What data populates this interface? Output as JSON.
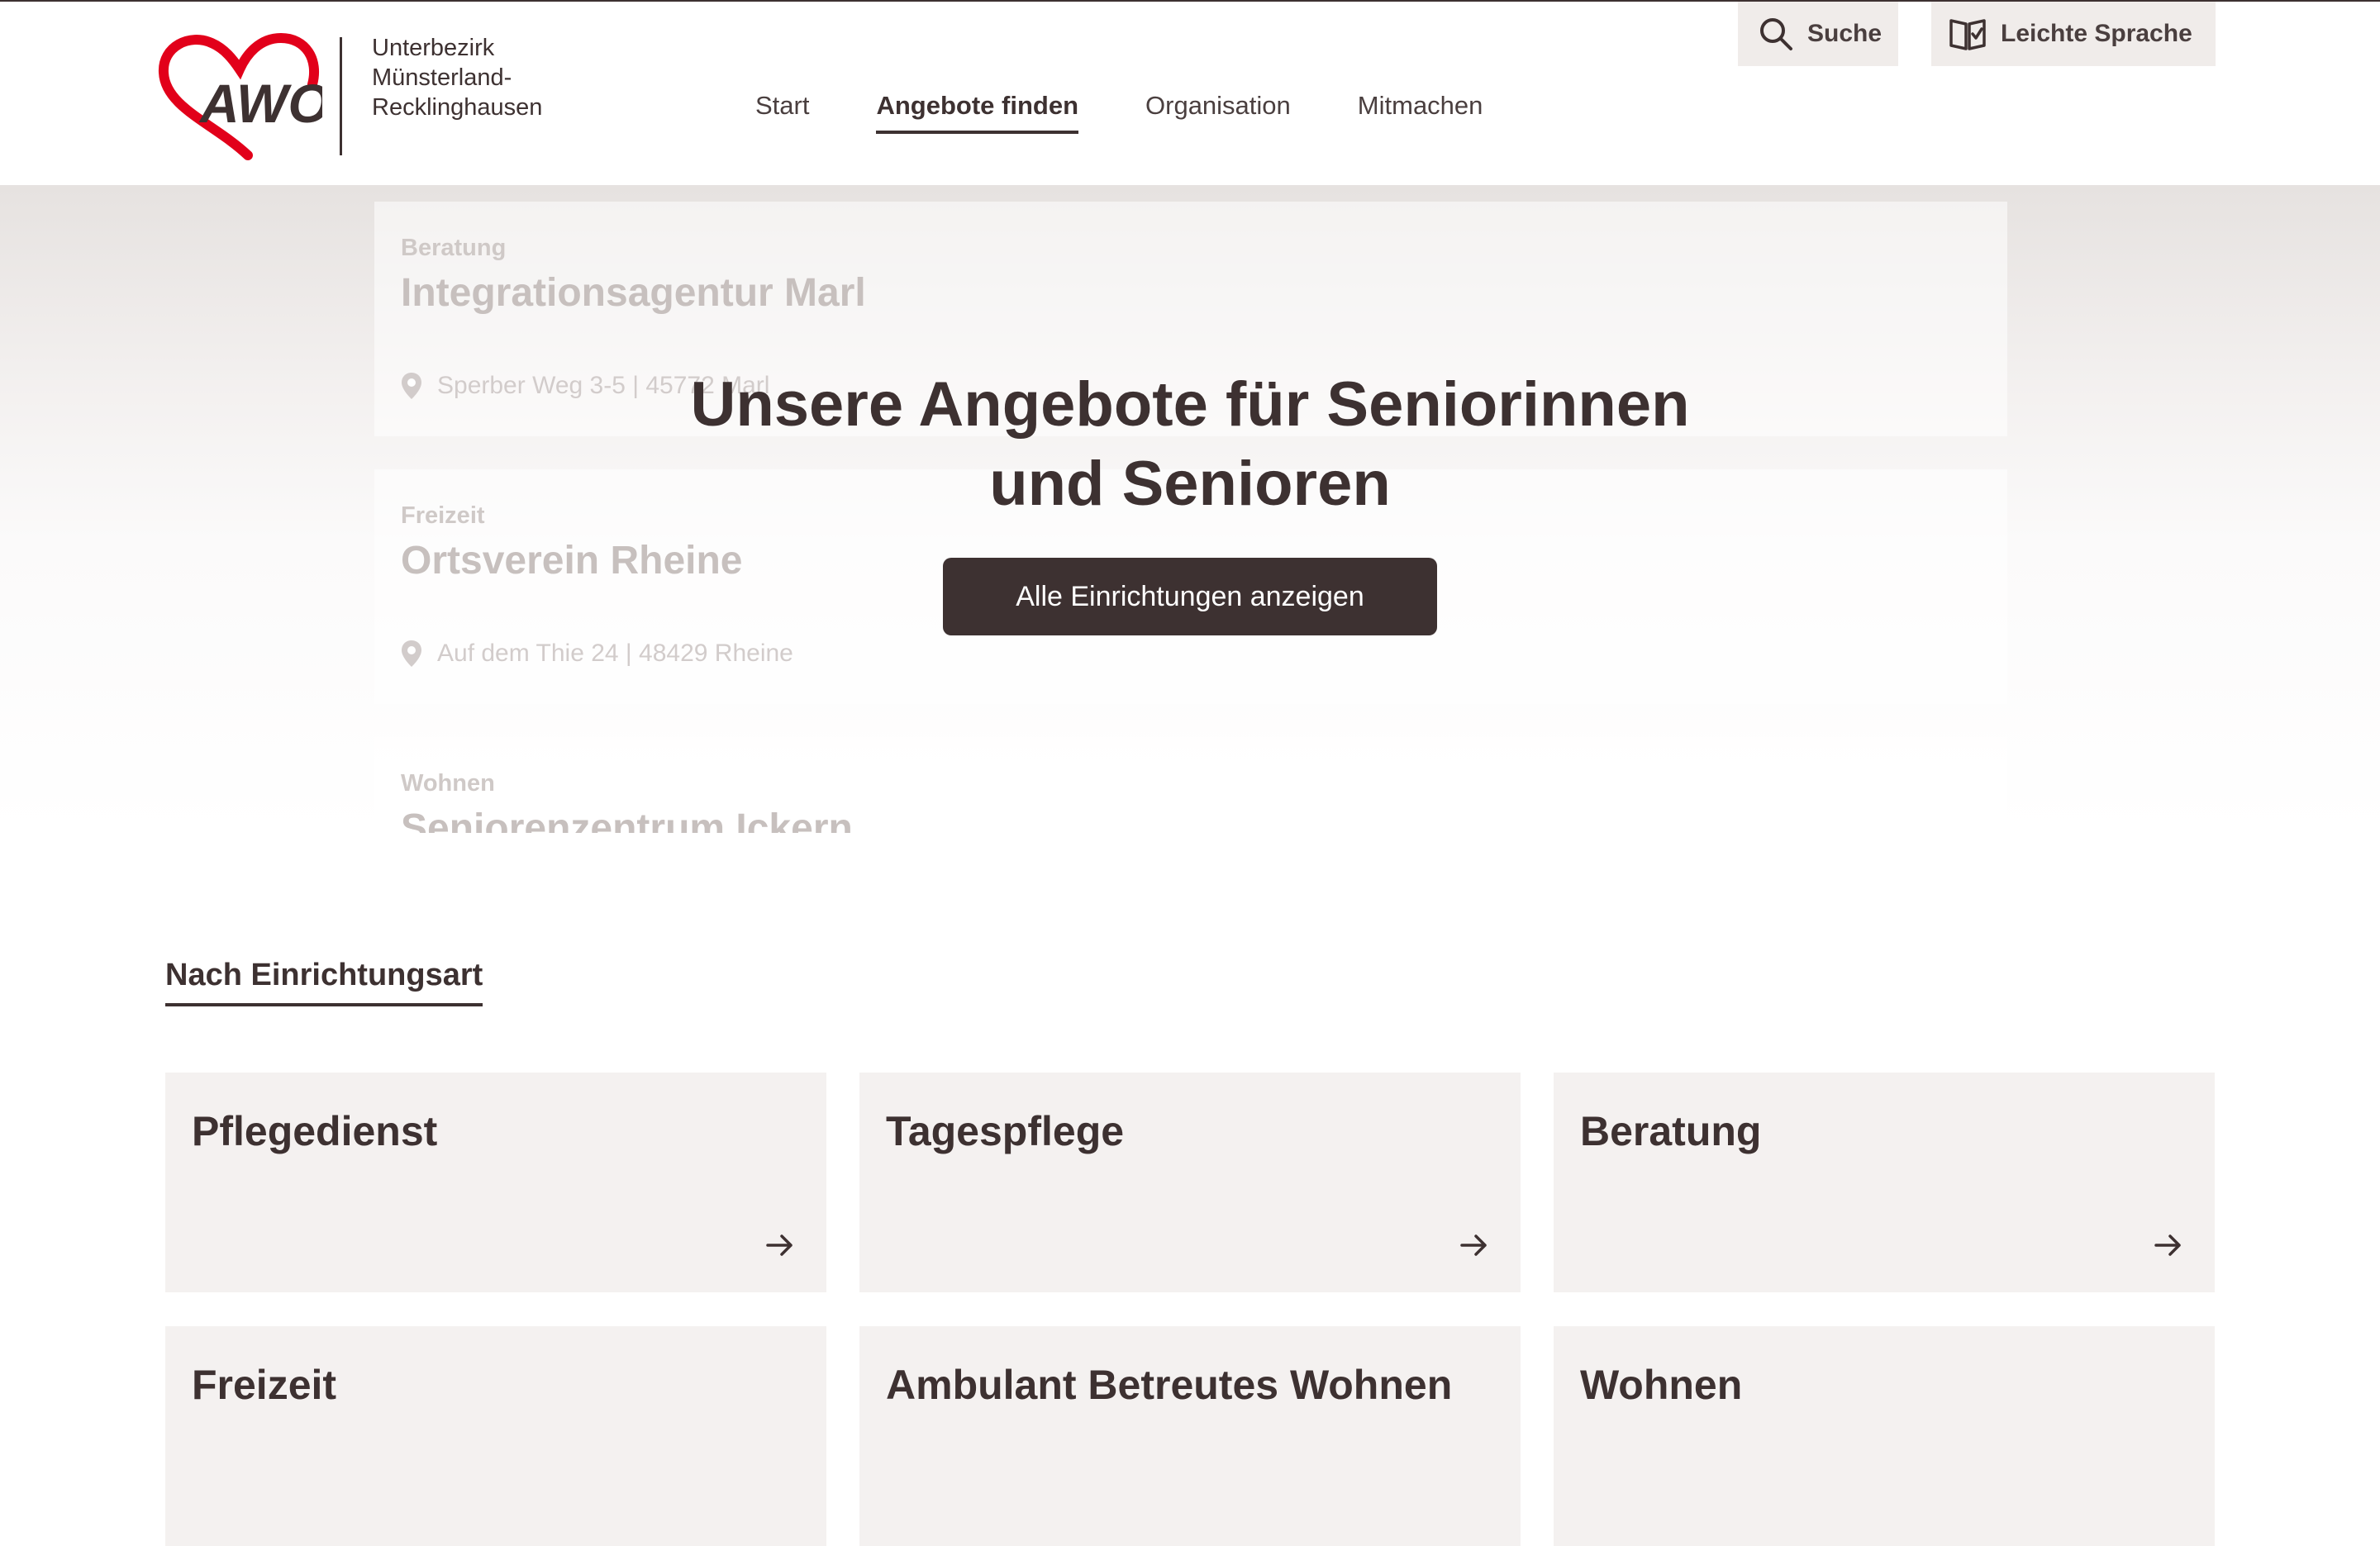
{
  "header": {
    "logo": {
      "mark_text": "AWO",
      "org_lines": [
        "Unterbezirk",
        "Münsterland-",
        "Recklinghausen"
      ]
    },
    "nav": [
      {
        "label": "Start",
        "active": false
      },
      {
        "label": "Angebote finden",
        "active": true
      },
      {
        "label": "Organisation",
        "active": false
      },
      {
        "label": "Mitmachen",
        "active": false
      }
    ],
    "search_label": "Suche",
    "easy_language_label": "Leichte Sprache"
  },
  "hero": {
    "title_lines": [
      "Unsere Angebote für Seniorinnen",
      "und Senioren"
    ],
    "button_label": "Alle Einrichtungen anzeigen",
    "background_cards": [
      {
        "category": "Beratung",
        "name": "Integrationsagentur Marl",
        "address": "Sperber Weg 3-5 | 45772 Marl"
      },
      {
        "category": "Freizeit",
        "name": "Ortsverein Rheine",
        "address": "Auf dem Thie 24 | 48429 Rheine"
      },
      {
        "category": "Wohnen",
        "name": "Seniorenzentrum Ickern",
        "address": ""
      }
    ]
  },
  "section": {
    "title": "Nach Einrichtungsart",
    "tiles": [
      {
        "label": "Pflegedienst"
      },
      {
        "label": "Tagespflege"
      },
      {
        "label": "Beratung"
      },
      {
        "label": "Freizeit"
      },
      {
        "label": "Ambulant Betreutes Wohnen"
      },
      {
        "label": "Wohnen"
      }
    ]
  },
  "colors": {
    "brand_dark": "#3d3131",
    "brand_red": "#e2001a",
    "tile_bg": "#f4f1f0",
    "util_button_bg": "#f0ecea"
  },
  "icons": [
    "search-icon",
    "book-icon",
    "location-pin-icon",
    "arrow-right-icon"
  ]
}
